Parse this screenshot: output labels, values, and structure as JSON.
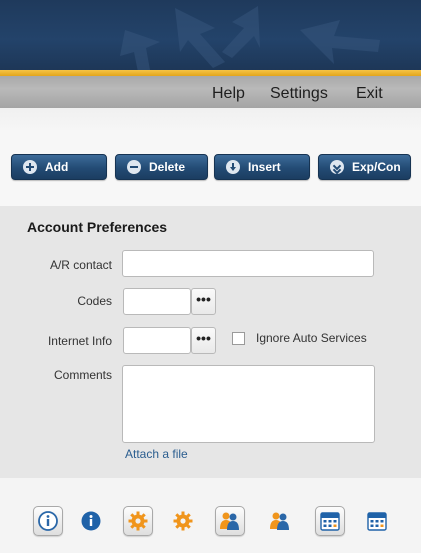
{
  "menu": {
    "help": "Help",
    "settings": "Settings",
    "exit": "Exit"
  },
  "actions": {
    "add": "Add",
    "delete": "Delete",
    "insert": "Insert",
    "expcon": "Exp/Con"
  },
  "form": {
    "title": "Account Preferences",
    "ar_contact_label": "A/R contact",
    "ar_contact_value": "",
    "codes_label": "Codes",
    "codes_value": "",
    "internet_label": "Internet Info",
    "internet_value": "",
    "ignore_auto_label": "Ignore Auto Services",
    "ignore_auto_checked": false,
    "comments_label": "Comments",
    "comments_value": "",
    "ellipsis": "•••",
    "attach_label": "Attach a file"
  },
  "toolbar": {
    "icons": [
      "info-icon",
      "info-icon",
      "gear-icon",
      "gear-icon",
      "users-icon",
      "users-icon",
      "calendar-icon",
      "calendar-icon"
    ]
  },
  "colors": {
    "accent_blue": "#234b74",
    "stripe_gold": "#f0b830",
    "link_blue": "#2a5d8f",
    "icon_orange": "#f0951c"
  }
}
